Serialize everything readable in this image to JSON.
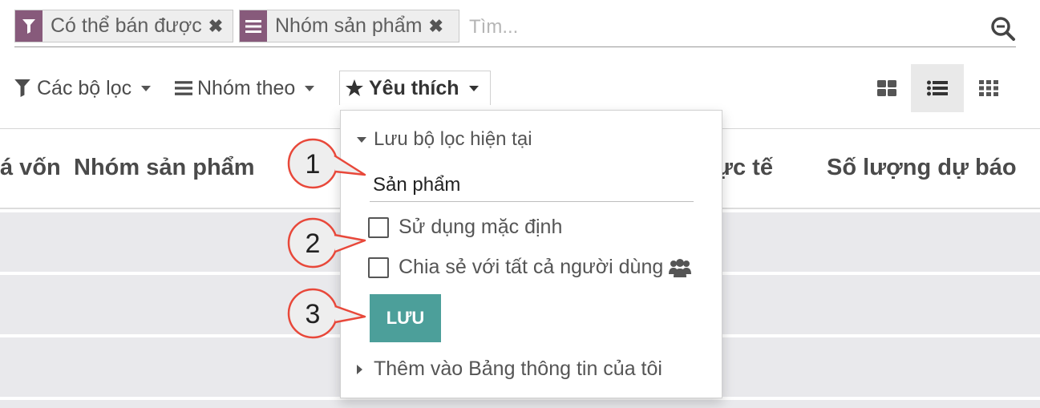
{
  "search": {
    "facets": [
      {
        "label": "Có thể bán được",
        "icon": "filter-icon",
        "remove": "✖"
      },
      {
        "label": "Nhóm sản phẩm",
        "icon": "group-by-icon",
        "remove": "✖"
      }
    ],
    "placeholder": "Tìm..."
  },
  "controls": {
    "filters_label": "Các bộ lọc",
    "groupby_label": "Nhóm theo",
    "favorites_label": "Yêu thích"
  },
  "table": {
    "columns": [
      "á vốn",
      "Nhóm sản phẩm",
      "ực tế",
      "Số lượng dự báo"
    ]
  },
  "favorites_menu": {
    "save_current_label": "Lưu bộ lọc hiện tại",
    "filter_name_value": "Sản phẩm",
    "use_default_label": "Sử dụng mặc định",
    "share_all_label": "Chia sẻ với tất cả người dùng",
    "save_button": "LƯU",
    "add_dashboard_label": "Thêm vào Bảng thông tin của tôi"
  },
  "callouts": [
    "1",
    "2",
    "3"
  ],
  "colors": {
    "accent": "#875a7b",
    "save_button": "#4c9f9a",
    "callout": "#e8483a"
  }
}
